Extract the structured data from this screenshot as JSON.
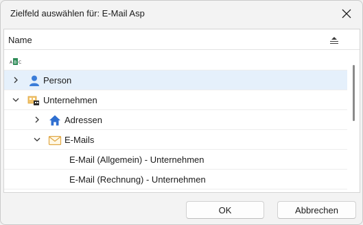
{
  "window": {
    "title": "Zielfeld auswählen für: E-Mail Asp",
    "close_icon": "close-icon"
  },
  "tree": {
    "column_header": "Name",
    "sort_icon": "sort-icon",
    "rows": [
      {
        "label": "",
        "icon": "abc-text-icon",
        "expander": "none",
        "selected": false
      },
      {
        "label": "Person",
        "icon": "person-icon",
        "expander": "chevron-right",
        "selected": true
      },
      {
        "label": "Unternehmen",
        "icon": "company-icon",
        "expander": "chevron-down",
        "selected": false
      },
      {
        "label": "Adressen",
        "icon": "home-icon",
        "expander": "chevron-right",
        "selected": false
      },
      {
        "label": "E-Mails",
        "icon": "envelope-icon",
        "expander": "chevron-down",
        "selected": false
      },
      {
        "label": "E-Mail (Allgemein) - Unternehmen",
        "icon": "",
        "expander": "none",
        "selected": false
      },
      {
        "label": "E-Mail (Rechnung) - Unternehmen",
        "icon": "",
        "expander": "none",
        "selected": false
      }
    ]
  },
  "footer": {
    "ok_label": "OK",
    "cancel_label": "Abbrechen"
  },
  "colors": {
    "selection": "#e5f0fb",
    "person_icon": "#3b7dd8",
    "home_icon": "#2f6fd0",
    "envelope_icon": "#e0a642",
    "company_icon": "#e9b24d",
    "abc_icon": "#2e8b57"
  }
}
